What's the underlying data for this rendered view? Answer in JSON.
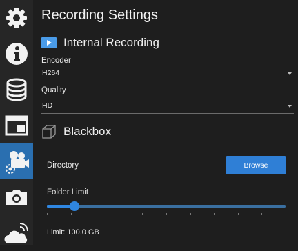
{
  "sidebar": {
    "items": [
      {
        "icon": "gear-icon",
        "active": false
      },
      {
        "icon": "info-icon",
        "active": false
      },
      {
        "icon": "database-icon",
        "active": false
      },
      {
        "icon": "layout-icon",
        "active": false
      },
      {
        "icon": "camera-settings-icon",
        "active": true
      },
      {
        "icon": "camera-icon",
        "active": false
      },
      {
        "icon": "cloud-broadcast-icon",
        "active": false
      }
    ]
  },
  "page": {
    "title": "Recording Settings"
  },
  "internal_recording": {
    "heading": "Internal Recording",
    "encoder": {
      "label": "Encoder",
      "value": "H264"
    },
    "quality": {
      "label": "Quality",
      "value": "HD"
    }
  },
  "blackbox": {
    "heading": "Blackbox",
    "directory": {
      "label": "Directory",
      "value": ""
    },
    "browse_label": "Browse",
    "folder_limit": {
      "label": "Folder Limit",
      "fraction": 0.115
    },
    "limit_readout": "Limit:  100.0 GB"
  },
  "colors": {
    "accent": "#2f7fd6",
    "active_sidebar": "#2a6fb0",
    "background": "#1e1e1e"
  }
}
